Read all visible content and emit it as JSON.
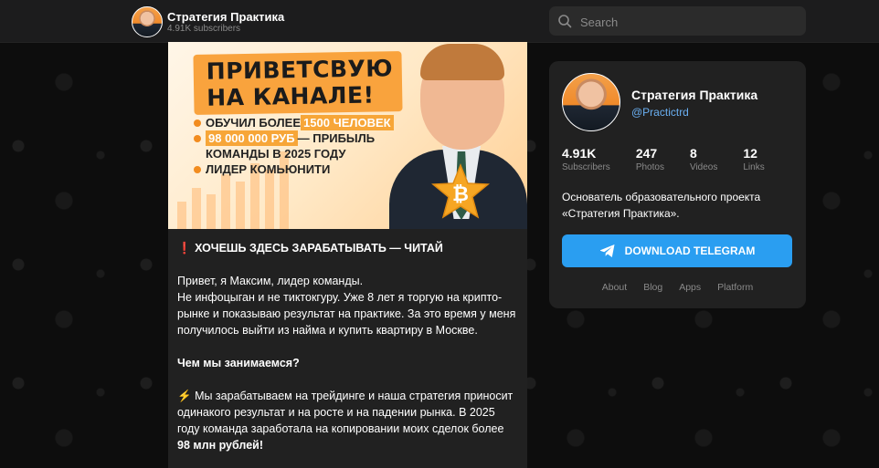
{
  "header": {
    "title": "Стратегия Практика",
    "subscribers": "4.91K subscribers"
  },
  "search": {
    "placeholder": "Search"
  },
  "post": {
    "banner": {
      "headline_line1": "ПРИВЕТСВУЮ",
      "headline_line2": "НА КАНАЛЕ!",
      "line1_pre": "ОБУЧИЛ БОЛЕЕ ",
      "line1_hl": "1500 ЧЕЛОВЕК",
      "line2_hl": "98 000 000 РУБ",
      "line2_post": " — ПРИБЫЛЬ",
      "line3": "КОМАНДЫ В 2025 ГОДУ",
      "line4": "ЛИДЕР КОМЬЮНИТИ"
    },
    "heading_mark": "❗",
    "heading": "ХОЧЕШЬ ЗДЕСЬ ЗАРАБАТЫВАТЬ — ЧИТАЙ",
    "para1_line1": "Привет, я Максим, лидер команды.",
    "para1_rest": "Не инфоцыган и не тиктокгуру. Уже 8 лет я торгую на крипто-рынке и показываю результат на практике. За это время у меня получилось выйти из найма и купить квартиру в Москве.",
    "section_title": "Чем мы занимаемся?",
    "bolt": "⚡",
    "para2": "Мы зарабатываем на трейдинге и наша стратегия приносит одинакого результат и на росте и на падении рынка. В 2025 году команда заработала на копировании моих сделок более ",
    "para2_bold": "98 млн рублей!"
  },
  "sidebar": {
    "title": "Стратегия Практика",
    "handle": "@Practictrd",
    "stats": [
      {
        "value": "4.91K",
        "label": "Subscribers"
      },
      {
        "value": "247",
        "label": "Photos"
      },
      {
        "value": "8",
        "label": "Videos"
      },
      {
        "value": "12",
        "label": "Links"
      }
    ],
    "description": "Основатель образовательного проекта «Стратегия Практика».",
    "download_label": "DOWNLOAD TELEGRAM",
    "links": [
      "About",
      "Blog",
      "Apps",
      "Platform"
    ]
  },
  "colors": {
    "accent": "#2a9ef1",
    "link": "#6ab0f3",
    "banner_orange": "#f9a33d"
  }
}
